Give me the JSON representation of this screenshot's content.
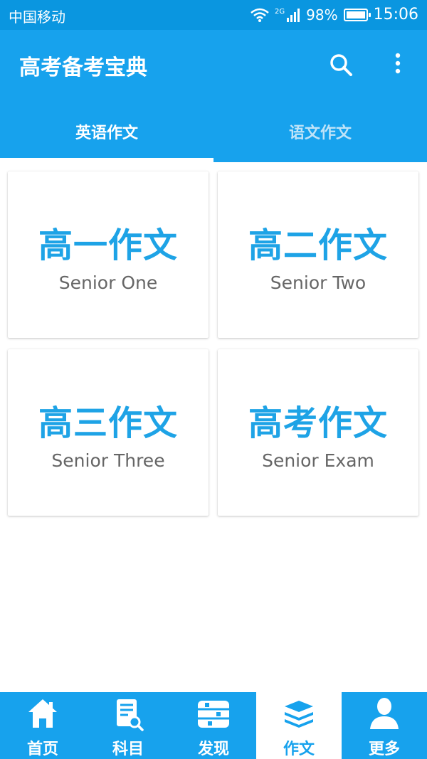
{
  "status_bar": {
    "carrier": "中国移动",
    "network": "2G",
    "battery": "98%",
    "time": "15:06"
  },
  "app_bar": {
    "title": "高考备考宝典",
    "search_icon": "search-icon",
    "more_icon": "more-vertical-icon"
  },
  "tabs": [
    {
      "label": "英语作文",
      "active": true
    },
    {
      "label": "语文作文",
      "active": false
    }
  ],
  "cards": [
    {
      "title": "高一作文",
      "subtitle": "Senior One"
    },
    {
      "title": "高二作文",
      "subtitle": "Senior Two"
    },
    {
      "title": "高三作文",
      "subtitle": "Senior Three"
    },
    {
      "title": "高考作文",
      "subtitle": "Senior Exam"
    }
  ],
  "bottom_nav": [
    {
      "label": "首页",
      "icon": "home-icon",
      "active": false
    },
    {
      "label": "科目",
      "icon": "subject-book-icon",
      "active": false
    },
    {
      "label": "发现",
      "icon": "discover-icon",
      "active": false
    },
    {
      "label": "作文",
      "icon": "essay-stack-icon",
      "active": true
    },
    {
      "label": "更多",
      "icon": "user-icon",
      "active": false
    }
  ],
  "colors": {
    "primary": "#17a2ed",
    "status_bar": "#0a96e0",
    "card_title": "#1ea3e6",
    "card_subtitle": "#666666"
  }
}
